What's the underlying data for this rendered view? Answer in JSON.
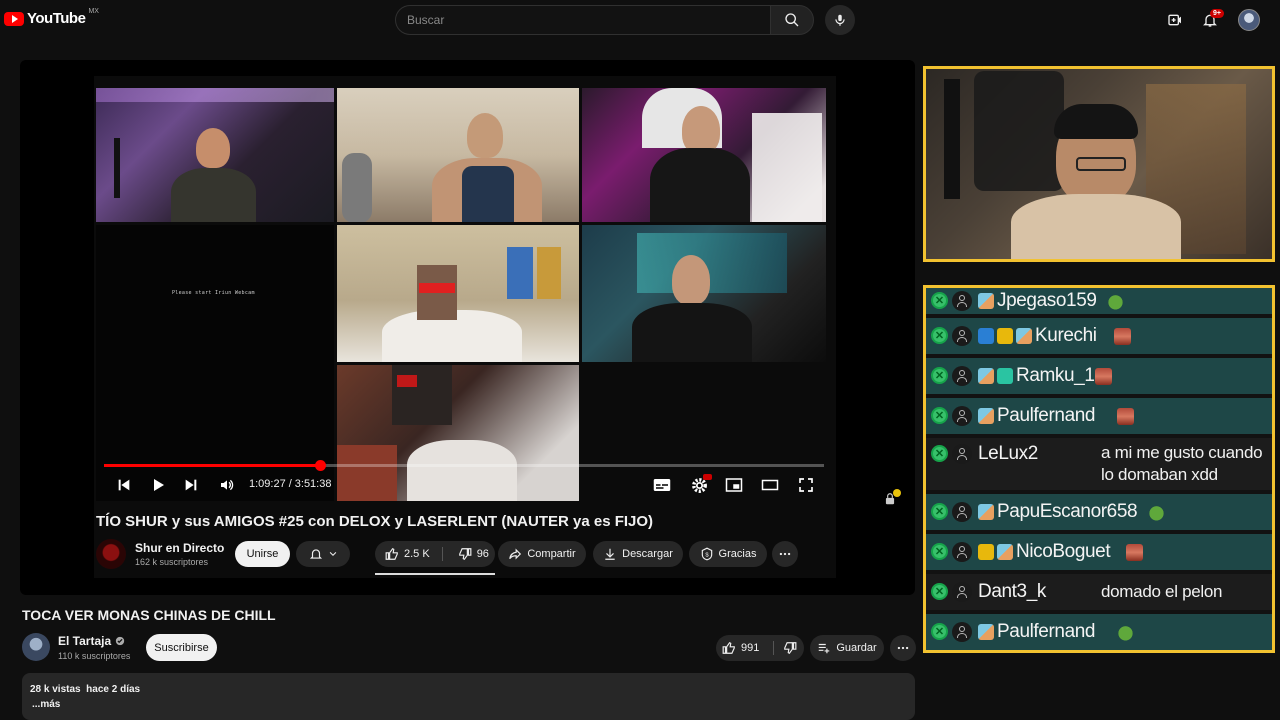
{
  "header": {
    "logo_text": "YouTube",
    "logo_country": "MX",
    "search_placeholder": "Buscar",
    "notification_count": "9+"
  },
  "player": {
    "webcam_message": "Please start Iriun Webcam",
    "current_time": "1:09:27",
    "separator": "/",
    "duration": "3:51:38",
    "progress_fraction": 0.3
  },
  "inner_video": {
    "title": "TÍO SHUR y sus AMIGOS #25 con DELOX y LASERLENT (NAUTER ya es FIJO)",
    "channel_name": "Shur en Directo",
    "channel_subs": "162 k suscriptores",
    "join_label": "Unirse",
    "likes": "2.5 K",
    "dislikes": "96",
    "share_label": "Compartir",
    "download_label": "Descargar",
    "thanks_label": "Gracias"
  },
  "chat": {
    "messages": [
      {
        "name": "Jpegaso159",
        "text": "",
        "badges": [
          "badge-cat"
        ],
        "emote": "pepe"
      },
      {
        "name": "Kurechi",
        "text": "",
        "badges": [
          "badge-bolt",
          "badge-crown",
          "badge-cat"
        ],
        "emote": "face"
      },
      {
        "name": "Ramku_1",
        "text": "",
        "badges": [
          "badge-cat",
          "badge-tv"
        ],
        "emote": "face"
      },
      {
        "name": "Paulfernand",
        "text": "",
        "badges": [
          "badge-cat"
        ],
        "emote": "face"
      },
      {
        "name": "LeLux2",
        "text": "a mi me gusto cuando lo domaban xdd",
        "badges": [],
        "emote": ""
      },
      {
        "name": "PapuEscanor658",
        "text": "",
        "badges": [
          "badge-cat"
        ],
        "emote": "pepe"
      },
      {
        "name": "NicoBoguet",
        "text": "",
        "badges": [
          "badge-crown",
          "badge-cat"
        ],
        "emote": "face"
      },
      {
        "name": "Dant3_k",
        "text": "domado el pelon",
        "badges": [],
        "emote": ""
      },
      {
        "name": "Paulfernand",
        "text": "",
        "badges": [
          "badge-cat"
        ],
        "emote": "pepe"
      }
    ]
  },
  "video": {
    "title": "TOCA VER MONAS CHINAS DE CHILL",
    "channel_name": "El Tartaja",
    "channel_subs": "110 k suscriptores",
    "subscribe_label": "Suscribirse",
    "likes": "991",
    "save_label": "Guardar",
    "views": "28 k vistas",
    "uploaded": "hace 2 días",
    "more_label": "...más"
  },
  "colors": {
    "accent_red": "#ff0000",
    "frame_yellow": "#f2c230",
    "chat_highlight": "#1e4747",
    "mod_green": "#37c06a"
  }
}
